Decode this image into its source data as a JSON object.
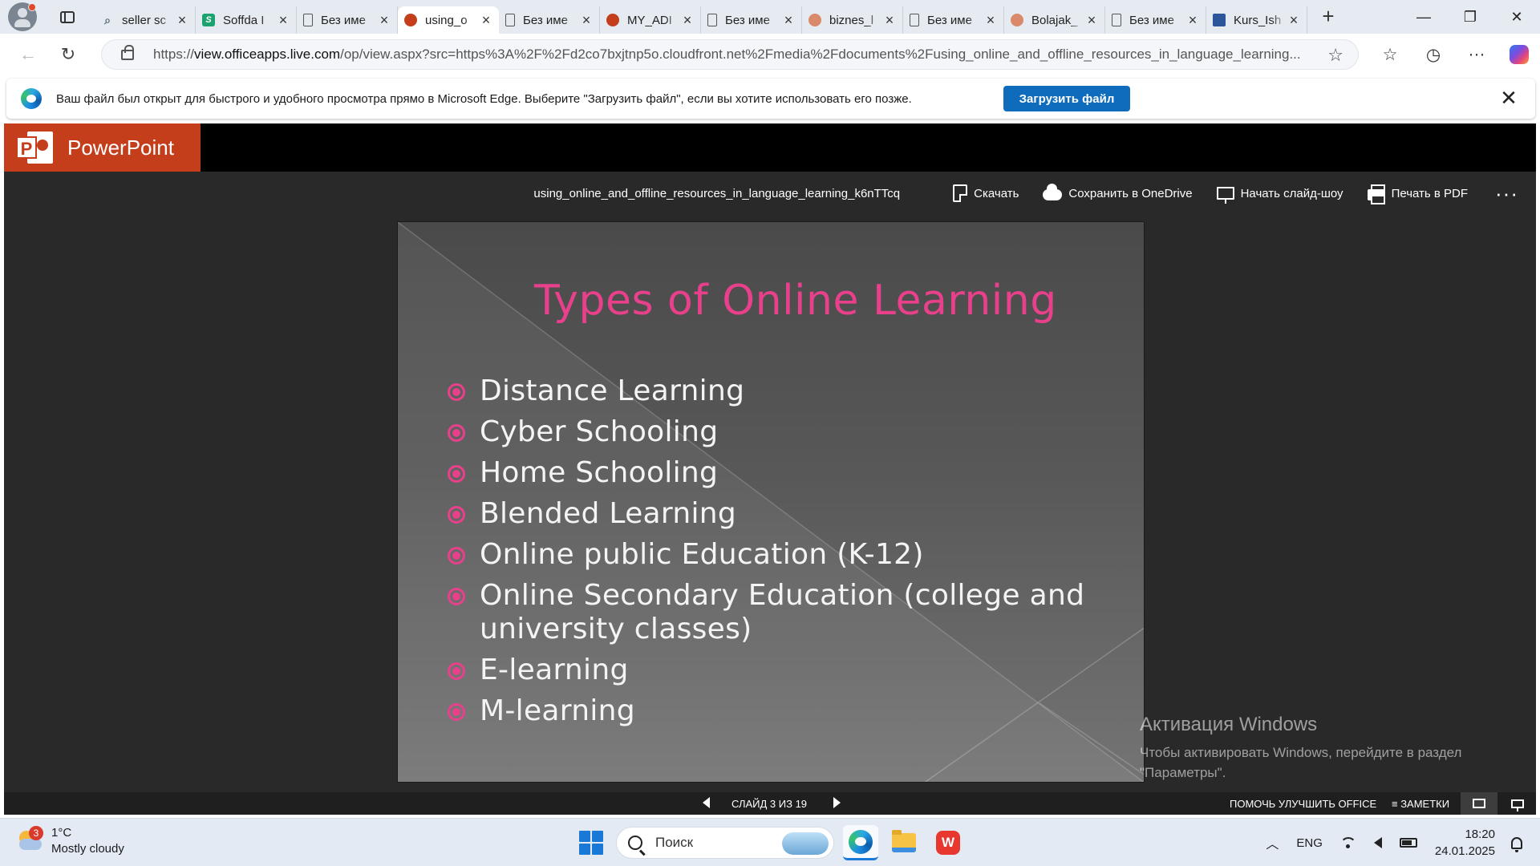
{
  "browser": {
    "tabs": [
      {
        "label": "seller sc",
        "favicon": "search-icon",
        "active": false
      },
      {
        "label": "Soffda I",
        "favicon": "soffda-icon",
        "active": false
      },
      {
        "label": "Без име",
        "favicon": "document-icon",
        "active": false
      },
      {
        "label": "using_o",
        "favicon": "powerpoint-icon",
        "active": true
      },
      {
        "label": "Без име",
        "favicon": "document-icon",
        "active": false
      },
      {
        "label": "MY_ADI",
        "favicon": "powerpoint-icon",
        "active": false
      },
      {
        "label": "Без име",
        "favicon": "document-icon",
        "active": false
      },
      {
        "label": "biznes_l",
        "favicon": "powerpoint-icon",
        "active": false
      },
      {
        "label": "Без име",
        "favicon": "document-icon",
        "active": false
      },
      {
        "label": "Bolajak_",
        "favicon": "powerpoint-icon",
        "active": false
      },
      {
        "label": "Без име",
        "favicon": "document-icon",
        "active": false
      },
      {
        "label": "Kurs_Ish",
        "favicon": "word-icon",
        "active": false
      }
    ],
    "url_prefix": "https://",
    "url_host": "view.officeapps.live.com",
    "url_path": "/op/view.aspx?src=https%3A%2F%2Fd2co7bxjtnp5o.cloudfront.net%2Fmedia%2Fdocuments%2Fusing_online_and_offline_resources_in_language_learning...",
    "infobar_text": "Ваш файл был открыт для быстрого и удобного просмотра прямо в Microsoft Edge. Выберите \"Загрузить файл\", если вы хотите использовать его позже.",
    "infobar_button": "Загрузить файл"
  },
  "powerpoint": {
    "app_name": "PowerPoint",
    "file_name": "using_online_and_offline_resources_in_language_learning_k6nTTcq",
    "commands": {
      "download": "Скачать",
      "save_onedrive": "Сохранить в OneDrive",
      "slideshow": "Начать слайд-шоу",
      "print_pdf": "Печать в PDF"
    },
    "slide": {
      "title": "Types of Online Learning",
      "bullets": [
        "Distance Learning",
        "Cyber Schooling",
        "Home Schooling",
        "Blended Learning",
        "Online public Education (K-12)",
        "Online Secondary Education (college and university classes)",
        "E-learning",
        "M-learning"
      ]
    },
    "status": {
      "slide_counter": "СЛАЙД 3 ИЗ 19",
      "help_improve": "ПОМОЧЬ УЛУЧШИТЬ OFFICE",
      "notes": "ЗАМЕТКИ"
    }
  },
  "watermark": {
    "line1": "Активация Windows",
    "line2": "Чтобы активировать Windows, перейдите в раздел",
    "line3": "\"Параметры\"."
  },
  "taskbar": {
    "weather_badge": "3",
    "temperature": "1°C",
    "condition": "Mostly cloudy",
    "search_placeholder": "Поиск",
    "wps_label": "W",
    "language": "ENG",
    "time": "18:20",
    "date": "24.01.2025"
  },
  "colors": {
    "powerpoint_brand": "#c43e1c",
    "slide_title": "#e8408a",
    "download_button": "#0f6cbd"
  }
}
